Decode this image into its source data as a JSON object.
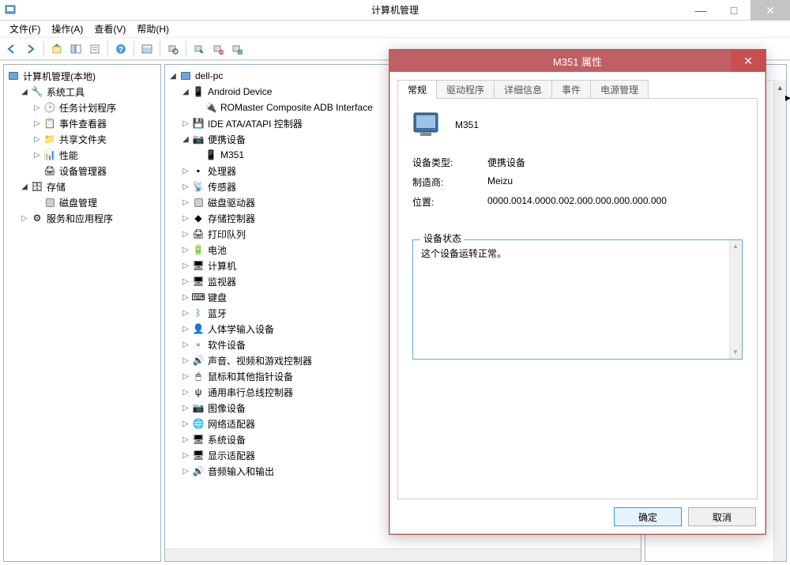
{
  "window": {
    "title": "计算机管理",
    "controls": {
      "min": "—",
      "max": "□",
      "close": "✕"
    }
  },
  "menu": {
    "file": "文件(F)",
    "action": "操作(A)",
    "view": "查看(V)",
    "help": "帮助(H)"
  },
  "left_tree": {
    "root": "计算机管理(本地)",
    "sys_tools": "系统工具",
    "task_sched": "任务计划程序",
    "event_viewer": "事件查看器",
    "shared_folders": "共享文件夹",
    "perf": "性能",
    "device_mgr": "设备管理器",
    "storage": "存储",
    "disk_mgmt": "磁盘管理",
    "services": "服务和应用程序"
  },
  "mid_tree": {
    "root": "dell-pc",
    "android": "Android Device",
    "adb": "ROMaster Composite ADB Interface",
    "ide": "IDE ATA/ATAPI 控制器",
    "portable": "便携设备",
    "m351": "M351",
    "cpu": "处理器",
    "sensor": "传感器",
    "diskdrive": "磁盘驱动器",
    "storctrl": "存储控制器",
    "printq": "打印队列",
    "battery": "电池",
    "computer": "计算机",
    "monitor": "监视器",
    "keyboard": "键盘",
    "bluetooth": "蓝牙",
    "hid": "人体学输入设备",
    "software": "软件设备",
    "sound": "声音、视频和游戏控制器",
    "mouse": "鼠标和其他指针设备",
    "usb": "通用串行总线控制器",
    "image": "图像设备",
    "netadapter": "网络适配器",
    "sysdev": "系统设备",
    "display": "显示适配器",
    "audio": "音频输入和输出"
  },
  "dialog": {
    "title": "M351 属性",
    "tabs": {
      "general": "常规",
      "driver": "驱动程序",
      "details": "详细信息",
      "events": "事件",
      "power": "电源管理"
    },
    "device_name": "M351",
    "labels": {
      "type": "设备类型:",
      "mfr": "制造商:",
      "location": "位置:",
      "status_group": "设备状态"
    },
    "values": {
      "type": "便携设备",
      "mfr": "Meizu",
      "location": "0000.0014.0000.002.000.000.000.000.000"
    },
    "status_text": "这个设备运转正常。",
    "buttons": {
      "ok": "确定",
      "cancel": "取消"
    }
  }
}
